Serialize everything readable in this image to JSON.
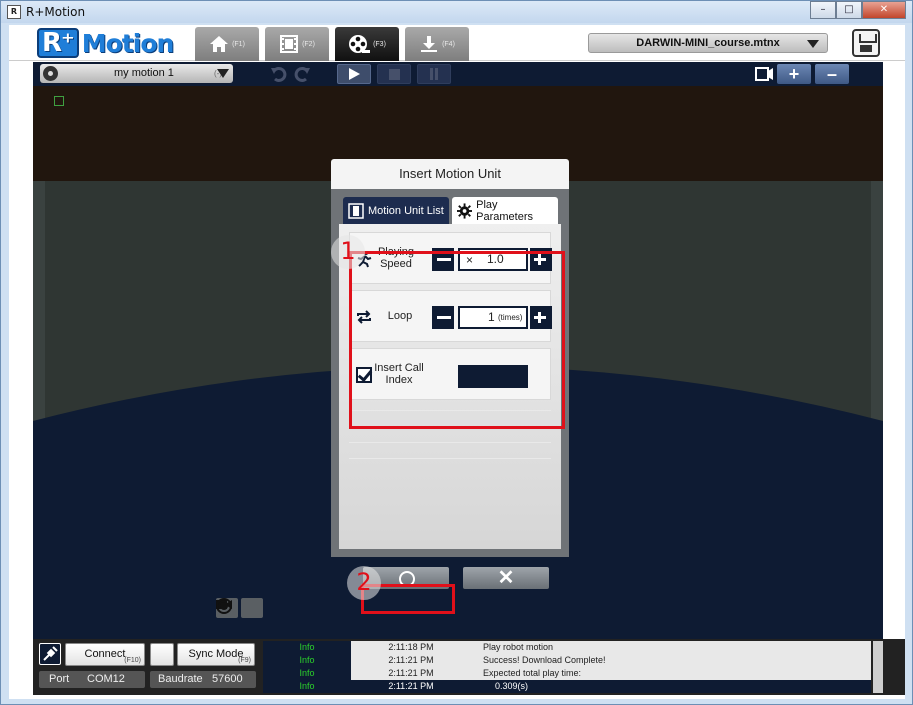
{
  "window": {
    "title": "R+Motion",
    "icon_text": "R",
    "controls": [
      "minimize-icon",
      "maximize-icon",
      "close-icon"
    ]
  },
  "header": {
    "logo_r": "R⁺",
    "logo_motion": "Motion",
    "tabs": [
      {
        "icon": "home-icon",
        "key": "(F1)"
      },
      {
        "icon": "film-icon",
        "key": "(F2)"
      },
      {
        "icon": "motion-reel-icon",
        "key": "(F3)"
      },
      {
        "icon": "download-icon",
        "key": "(F4)"
      }
    ],
    "active_tab_index": 2,
    "file_name": "DARWIN-MINI_course.mtnx"
  },
  "toolbar": {
    "motion_name": "my motion 1",
    "motion_suffix": "(-)"
  },
  "dialog": {
    "title": "Insert Motion Unit",
    "tabs": [
      {
        "label": "Motion Unit List",
        "icon": "film-icon"
      },
      {
        "label": "Play Parameters",
        "icon": "gear-icon"
      }
    ],
    "playing_speed": {
      "label_line1": "Playing",
      "label_line2": "Speed",
      "prefix": "×",
      "value": "1.0"
    },
    "loop": {
      "label": "Loop",
      "value": "1",
      "unit": "(times)"
    },
    "insert_call_index": {
      "label_line1": "Insert Call",
      "label_line2": "Index",
      "checked": true
    },
    "ok_icon": "circle-icon",
    "cancel_label": "✕"
  },
  "annotations": {
    "badge_1": "1",
    "badge_2": "2",
    "color": "#e0101a"
  },
  "statusbar": {
    "connect_label": "Connect",
    "connect_key": "(F10)",
    "sync_label": "Sync Mode",
    "sync_key": "(F9)",
    "port_label": "Port",
    "port_value": "COM12",
    "baud_label": "Baudrate",
    "baud_value": "57600"
  },
  "log": [
    {
      "level": "Info",
      "time": "2:11:18 PM",
      "message": "Play robot motion"
    },
    {
      "level": "Info",
      "time": "2:11:21 PM",
      "message": "Success! Download Complete!"
    },
    {
      "level": "Info",
      "time": "2:11:21 PM",
      "message": "Expected total play time:"
    },
    {
      "level": "Info",
      "time": "2:11:21 PM",
      "message": "0.309(s)"
    }
  ],
  "colors": {
    "navy": "#0e1b33",
    "accent_blue": "#1f7ed8",
    "log_green": "#2bd12b"
  }
}
